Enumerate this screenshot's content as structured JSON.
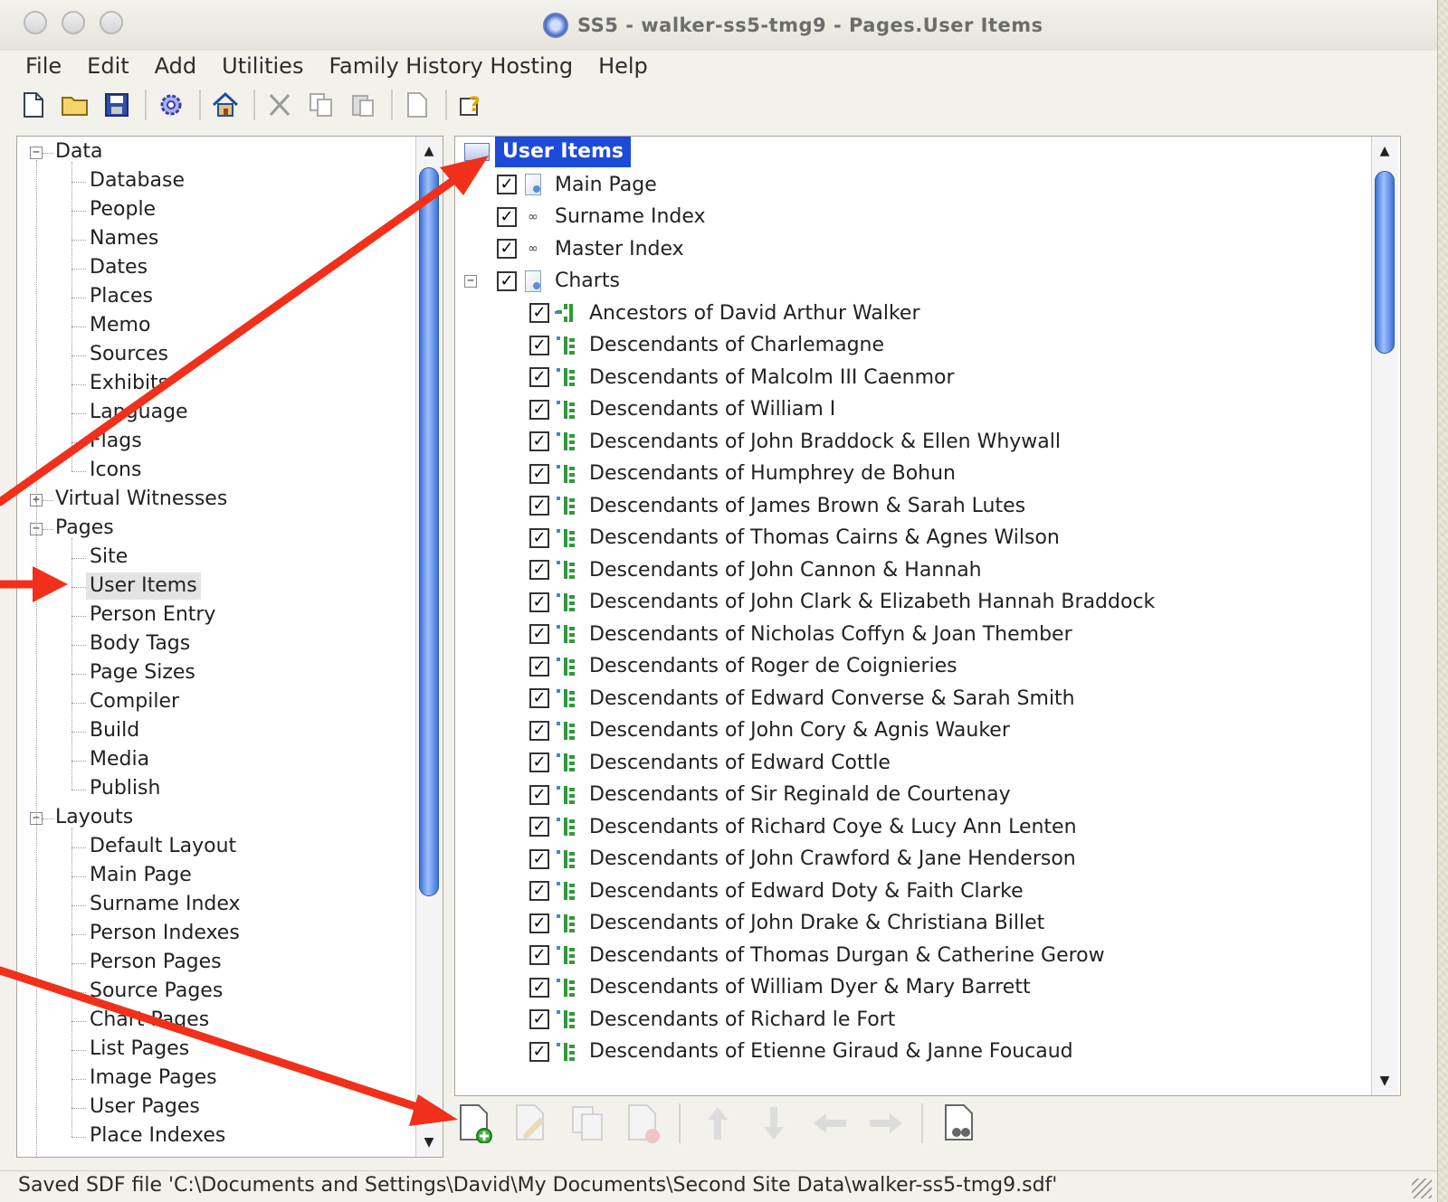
{
  "window": {
    "title": "SS5 - walker-ss5-tmg9 - Pages.User Items"
  },
  "menu": [
    "File",
    "Edit",
    "Add",
    "Utilities",
    "Family History Hosting",
    "Help"
  ],
  "toolbar_icons": [
    "new-file-icon",
    "open-folder-icon",
    "save-icon",
    "settings-gear-icon",
    "home-icon",
    "cut-icon",
    "copy-icon",
    "paste-icon",
    "blank-page-icon",
    "help-icon"
  ],
  "left_tree": {
    "data": {
      "label": "Data",
      "children": [
        "Database",
        "People",
        "Names",
        "Dates",
        "Places",
        "Memo",
        "Sources",
        "Exhibits",
        "Language",
        "Flags",
        "Icons"
      ]
    },
    "virtual_witnesses": {
      "label": "Virtual Witnesses"
    },
    "pages": {
      "label": "Pages",
      "children": [
        "Site",
        "User Items",
        "Person Entry",
        "Body Tags",
        "Page Sizes",
        "Compiler",
        "Build",
        "Media",
        "Publish"
      ],
      "selected": "User Items"
    },
    "layouts": {
      "label": "Layouts",
      "children": [
        "Default Layout",
        "Main Page",
        "Surname Index",
        "Person Indexes",
        "Person Pages",
        "Source Pages",
        "Chart Pages",
        "List Pages",
        "Image Pages",
        "User Pages",
        "Place Indexes"
      ]
    }
  },
  "right_tree": {
    "header": "User Items",
    "top_items": [
      {
        "label": "Main Page",
        "icon": "page-icon",
        "checked": true
      },
      {
        "label": "Surname Index",
        "icon": "link-icon",
        "checked": true
      },
      {
        "label": "Master Index",
        "icon": "link-icon",
        "checked": true
      }
    ],
    "charts": {
      "label": "Charts",
      "checked": true,
      "items": [
        "Ancestors of David Arthur Walker",
        "Descendants of Charlemagne",
        "Descendants of Malcolm III Caenmor",
        "Descendants of William I",
        "Descendants of John Braddock & Ellen Whywall",
        "Descendants of Humphrey de Bohun",
        "Descendants of James Brown & Sarah Lutes",
        "Descendants of Thomas Cairns & Agnes Wilson",
        "Descendants of John Cannon & Hannah",
        "Descendants of John Clark & Elizabeth Hannah Braddock",
        "Descendants of Nicholas Coffyn & Joan Thember",
        "Descendants of Roger de Coignieries",
        "Descendants of Edward Converse & Sarah Smith",
        "Descendants of John Cory & Agnis Wauker",
        "Descendants of Edward Cottle",
        "Descendants of Sir Reginald de Courtenay",
        "Descendants of Richard Coye & Lucy Ann Lenten",
        "Descendants of John Crawford & Jane Henderson",
        "Descendants of Edward Doty & Faith Clarke",
        "Descendants of John Drake & Christiana Billet",
        "Descendants of Thomas Durgan & Catherine Gerow",
        "Descendants of William Dyer & Mary Barrett",
        "Descendants of Richard le Fort",
        "Descendants of Etienne Giraud & Janne Foucaud"
      ]
    }
  },
  "bottom_buttons": [
    "add-item-icon",
    "edit-item-icon",
    "copy-item-icon",
    "delete-item-icon",
    "move-up-icon",
    "move-down-icon",
    "move-left-icon",
    "move-right-icon",
    "find-icon"
  ],
  "status": "Saved SDF file 'C:\\Documents and Settings\\David\\My Documents\\Second Site Data\\walker-ss5-tmg9.sdf'",
  "colors": {
    "selection": "#1c4ad9",
    "annotation_arrow": "#f0301a",
    "scroll_thumb": "#3a73d8"
  }
}
